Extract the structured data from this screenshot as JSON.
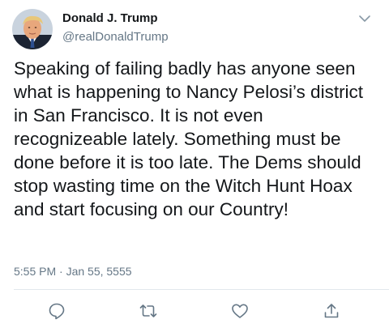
{
  "tweet": {
    "display_name": "Donald J. Trump",
    "handle": "@realDonaldTrump",
    "text": "Speaking of failing badly has anyone seen what is happening to Nancy Pelosi’s district in San Francisco. It is not even recognizeable lately. Something must be done before it is too late. The Dems should stop wasting time on the Witch Hunt Hoax and start focusing on our Country!",
    "timestamp": "5:55 PM · Jan 55, 5555"
  },
  "icons": {
    "more": "chevron-down-icon",
    "reply": "reply-icon",
    "retweet": "retweet-icon",
    "like": "heart-icon",
    "share": "share-icon"
  },
  "colors": {
    "text": "#14171a",
    "secondary": "#657786",
    "icon": "#657786",
    "divider": "#e1e8ed"
  }
}
